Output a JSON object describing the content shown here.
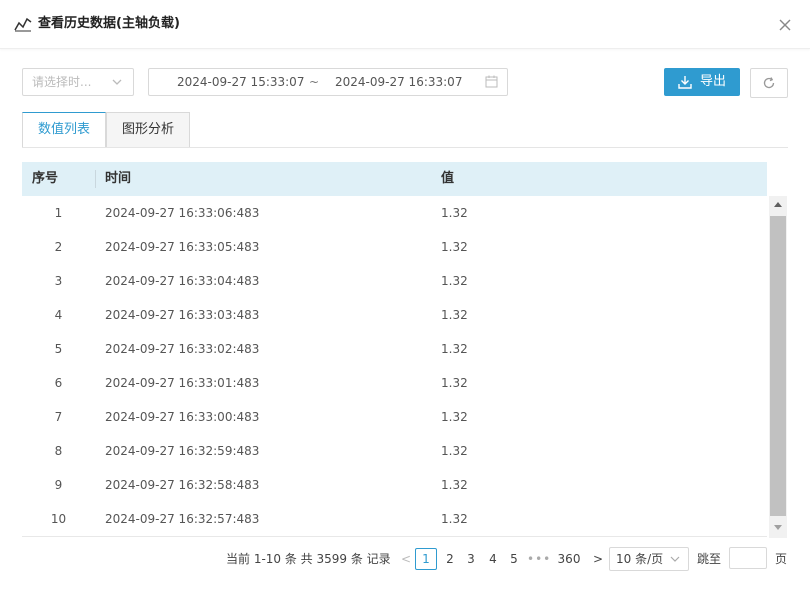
{
  "dialog": {
    "title": "查看历史数据(主轴负载)"
  },
  "filters": {
    "select_placeholder": "请选择时...",
    "date_start": "2024-09-27 15:33:07",
    "date_separator": "~",
    "date_end": "2024-09-27 16:33:07",
    "export_label": "导出"
  },
  "tabs": [
    {
      "label": "数值列表",
      "active": true
    },
    {
      "label": "图形分析",
      "active": false
    }
  ],
  "table": {
    "headers": {
      "index": "序号",
      "time": "时间",
      "value": "值"
    },
    "rows": [
      {
        "index": "1",
        "time": "2024-09-27 16:33:06:483",
        "value": "1.32"
      },
      {
        "index": "2",
        "time": "2024-09-27 16:33:05:483",
        "value": "1.32"
      },
      {
        "index": "3",
        "time": "2024-09-27 16:33:04:483",
        "value": "1.32"
      },
      {
        "index": "4",
        "time": "2024-09-27 16:33:03:483",
        "value": "1.32"
      },
      {
        "index": "5",
        "time": "2024-09-27 16:33:02:483",
        "value": "1.32"
      },
      {
        "index": "6",
        "time": "2024-09-27 16:33:01:483",
        "value": "1.32"
      },
      {
        "index": "7",
        "time": "2024-09-27 16:33:00:483",
        "value": "1.32"
      },
      {
        "index": "8",
        "time": "2024-09-27 16:32:59:483",
        "value": "1.32"
      },
      {
        "index": "9",
        "time": "2024-09-27 16:32:58:483",
        "value": "1.32"
      },
      {
        "index": "10",
        "time": "2024-09-27 16:32:57:483",
        "value": "1.32"
      }
    ]
  },
  "pagination": {
    "summary": "当前 1-10 条 共 3599 条 记录",
    "prev": "<",
    "pages": [
      "1",
      "2",
      "3",
      "4",
      "5"
    ],
    "ellipsis": "•••",
    "last_page": "360",
    "next": ">",
    "page_size": "10 条/页",
    "goto_label": "跳至",
    "goto_value": "",
    "goto_unit": "页"
  },
  "colors": {
    "accent": "#2f9bd0",
    "header_bg": "#dff0f7"
  },
  "icons": [
    "line-chart-icon",
    "close-icon",
    "chevron-down-icon",
    "calendar-icon",
    "download-icon",
    "refresh-icon"
  ]
}
